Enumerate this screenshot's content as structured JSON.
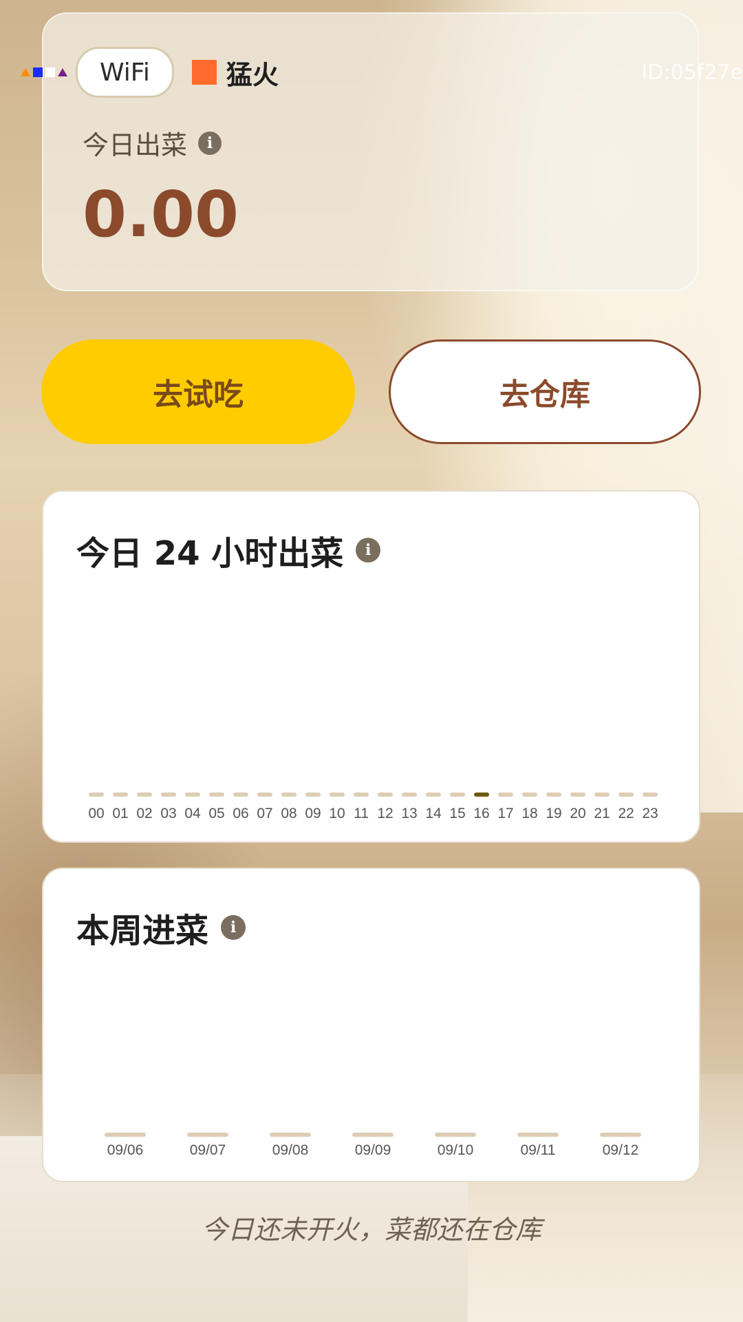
{
  "status": {
    "wifi_label": "WiFi",
    "fire_label": "猛火",
    "device_id": "ID:05f27e",
    "fire_color": "#ff6b2c"
  },
  "today": {
    "label": "今日出菜",
    "value": "0.00",
    "info_icon": "info-icon"
  },
  "buttons": {
    "try_label": "去试吃",
    "store_label": "去仓库"
  },
  "hourly": {
    "title": "今日 24 小时出菜",
    "chart_data": {
      "type": "bar",
      "categories": [
        "00",
        "01",
        "02",
        "03",
        "04",
        "05",
        "06",
        "07",
        "08",
        "09",
        "10",
        "11",
        "12",
        "13",
        "14",
        "15",
        "16",
        "17",
        "18",
        "19",
        "20",
        "21",
        "22",
        "23"
      ],
      "values": [
        0,
        0,
        0,
        0,
        0,
        0,
        0,
        0,
        0,
        0,
        0,
        0,
        0,
        0,
        0,
        0,
        0,
        0,
        0,
        0,
        0,
        0,
        0,
        0
      ],
      "highlight": "16",
      "colors": {
        "bar": "#dccdb4",
        "highlight": "#6b5a12"
      }
    }
  },
  "weekly": {
    "title": "本周进菜",
    "chart_data": {
      "type": "bar",
      "categories": [
        "09/06",
        "09/07",
        "09/08",
        "09/09",
        "09/10",
        "09/11",
        "09/12"
      ],
      "values": [
        0,
        0,
        0,
        0,
        0,
        0,
        0
      ],
      "colors": {
        "bar": "#dccdb4"
      }
    }
  },
  "footer": {
    "note": "今日还未开火，菜都还在仓库"
  }
}
